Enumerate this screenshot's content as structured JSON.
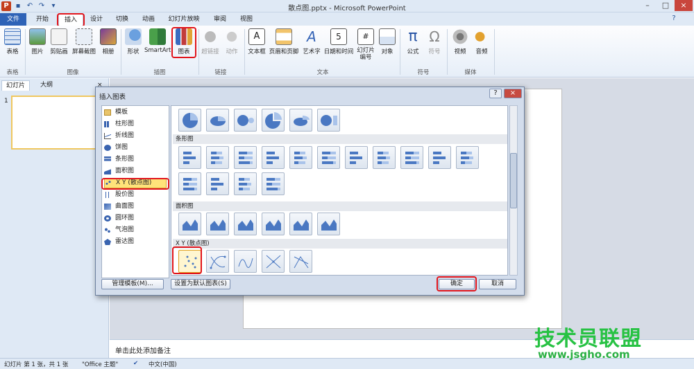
{
  "window": {
    "title": "散点图.pptx - Microsoft PowerPoint"
  },
  "tabs": [
    "文件",
    "开始",
    "插入",
    "设计",
    "切换",
    "动画",
    "幻灯片放映",
    "审阅",
    "视图"
  ],
  "ribbon": {
    "buttons": [
      "表格",
      "图片",
      "剪贴画",
      "屏幕截图",
      "相册",
      "形状",
      "SmartArt",
      "图表",
      "超链接",
      "动作",
      "文本框",
      "页眉和页脚",
      "艺术字",
      "日期和时间",
      "幻灯片编号",
      "对象",
      "公式",
      "符号",
      "视频",
      "音频"
    ],
    "groups": [
      "表格",
      "图像",
      "插图",
      "链接",
      "文本",
      "符号",
      "媒体"
    ]
  },
  "panel": {
    "tabs": [
      "幻灯片",
      "大纲"
    ],
    "slide_number": "1"
  },
  "dialog": {
    "title": "插入图表",
    "help": "?",
    "close": "×",
    "types": [
      "模板",
      "柱形图",
      "折线图",
      "饼图",
      "条形图",
      "面积图",
      "X Y (散点图)",
      "股价图",
      "曲面图",
      "圆环图",
      "气泡图",
      "雷达图"
    ],
    "sections": {
      "bar": "条形图",
      "area": "面积图",
      "scatter": "X Y (散点图)"
    },
    "manage_button": "管理模板(M)...",
    "set_default_button": "设置为默认图表(S)",
    "ok_button": "确定",
    "cancel_button": "取消"
  },
  "notes": {
    "placeholder": "单击此处添加备注"
  },
  "status": {
    "slide_info": "幻灯片 第 1 张，共 1 张",
    "theme": "\"Office 主题\"",
    "language": "中文(中国)"
  },
  "watermark": {
    "text": "技术员联盟",
    "url": "www.jsgho.com"
  },
  "colors": {
    "accent": "#2f63b7",
    "highlight": "#e1141b",
    "selected": "#ffe37a"
  }
}
